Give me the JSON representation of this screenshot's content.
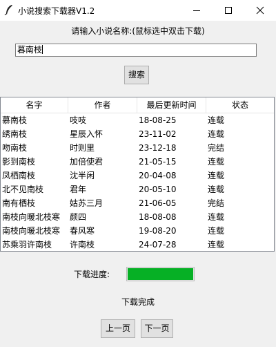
{
  "window": {
    "title": "小说搜索下载器V1.2",
    "icons": {
      "app": "feather-icon",
      "minimize": "minimize-icon",
      "maximize": "maximize-icon",
      "close": "close-icon"
    }
  },
  "search": {
    "prompt": "请输入小说名称:(鼠标选中双击下载)",
    "value": "暮南枝",
    "button_label": "搜索"
  },
  "table": {
    "columns": [
      "名字",
      "作者",
      "最后更新时间",
      "状态"
    ],
    "rows": [
      [
        "慕南枝",
        "吱吱",
        "18-08-25",
        "连载"
      ],
      [
        "绣南枝",
        "星辰入怀",
        "23-11-02",
        "连载"
      ],
      [
        "吻南枝",
        "时则里",
        "23-12-18",
        "完结"
      ],
      [
        "影到南枝",
        "加倍使君",
        "21-05-15",
        "连载"
      ],
      [
        "凤栖南枝",
        "沈半闲",
        "20-04-08",
        "连载"
      ],
      [
        "北不见南枝",
        "君年",
        "20-05-10",
        "连载"
      ],
      [
        "南有栖枝",
        "姑苏三月",
        "21-06-05",
        "完结"
      ],
      [
        "南枝向暖北枝寒",
        "颜四",
        "18-08-08",
        "连载"
      ],
      [
        "南枝向暖北枝寒",
        "春风寒",
        "19-08-20",
        "连载"
      ],
      [
        "苏乘羽许南枝",
        "许南枝",
        "24-07-28",
        "连载"
      ]
    ]
  },
  "download": {
    "progress_label": "下载进度:",
    "progress_percent": 100,
    "progress_color": "#06b025",
    "status": "下载完成"
  },
  "pagination": {
    "prev_label": "上一页",
    "next_label": "下一页"
  }
}
